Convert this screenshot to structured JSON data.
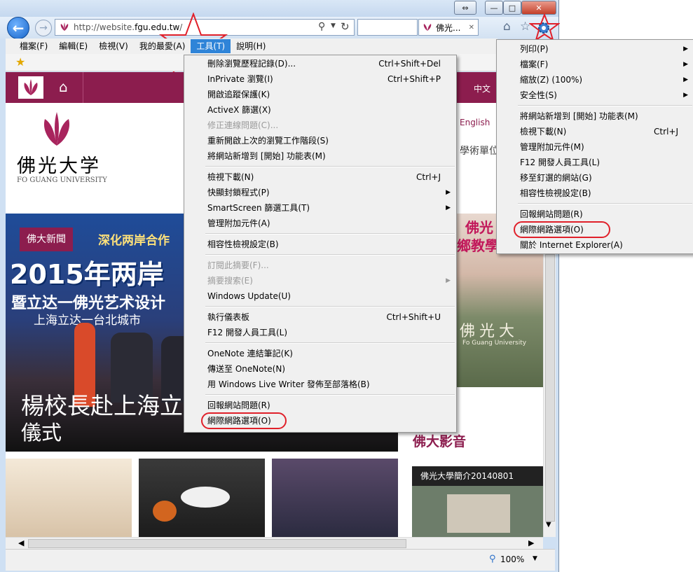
{
  "browser": {
    "url_prefix": "http://website.",
    "url_domain": "fgu.edu.tw",
    "url_suffix": "/",
    "tab_title": "佛光...",
    "tab_close": "✕",
    "zoom_label": "100%",
    "window_buttons": {
      "restore": "⇔",
      "minimize": "—",
      "maximize": "□",
      "close": "✕"
    }
  },
  "menubar": {
    "items": [
      "檔案(F)",
      "編輯(E)",
      "檢視(V)",
      "我的最愛(A)",
      "工具(T)",
      "說明(H)"
    ]
  },
  "site": {
    "lang_zh": "中文",
    "lang_en": "English",
    "dept_label": "學術單位",
    "logo_cn": "佛光大学",
    "logo_en": "FO GUANG UNIVERSITY",
    "news_badge": "佛大新聞",
    "banner_sub": "深化两岸合作",
    "banner_year": "2015年两岸",
    "banner_line2": "暨立达一佛光艺术设计",
    "banner_line3": "上海立达一台北城市",
    "headline_l1": "楊校長赴上海立",
    "headline_l2": "儀式",
    "right_top": "佛光",
    "right_mid": "鄉教學",
    "right_campus": "佛光大",
    "right_campus_en": "Fo Guang University",
    "video_title": "佛大影音",
    "video_caption": "佛光大學簡介20140801"
  },
  "tools_menu": {
    "groups": [
      [
        {
          "label": "刪除瀏覽歷程記錄(D)...",
          "shortcut": "Ctrl+Shift+Del"
        },
        {
          "label": "InPrivate 瀏覽(I)",
          "shortcut": "Ctrl+Shift+P"
        },
        {
          "label": "開啟追蹤保護(K)"
        },
        {
          "label": "ActiveX 篩選(X)"
        },
        {
          "label": "修正連線問題(C)...",
          "disabled": true
        },
        {
          "label": "重新開啟上次的瀏覽工作階段(S)"
        },
        {
          "label": "將網站新增到 [開始] 功能表(M)"
        }
      ],
      [
        {
          "label": "檢視下載(N)",
          "shortcut": "Ctrl+J"
        },
        {
          "label": "快顯封鎖程式(P)",
          "submenu": true
        },
        {
          "label": "SmartScreen 篩選工具(T)",
          "submenu": true
        },
        {
          "label": "管理附加元件(A)"
        }
      ],
      [
        {
          "label": "相容性檢視設定(B)"
        }
      ],
      [
        {
          "label": "訂閱此摘要(F)...",
          "disabled": true
        },
        {
          "label": "摘要搜索(E)",
          "disabled": true,
          "submenu": true
        },
        {
          "label": "Windows Update(U)"
        }
      ],
      [
        {
          "label": "執行儀表板",
          "shortcut": "Ctrl+Shift+U"
        },
        {
          "label": "F12 開發人員工具(L)"
        }
      ],
      [
        {
          "label": "OneNote 連結筆記(K)"
        },
        {
          "label": "傳送至 OneNote(N)"
        },
        {
          "label": "用 Windows Live Writer 發佈至部落格(B)"
        }
      ],
      [
        {
          "label": "回報網站問題(R)"
        },
        {
          "label": "網際網路選項(O)",
          "highlight": true
        }
      ]
    ]
  },
  "gear_menu": {
    "groups": [
      [
        {
          "label": "列印(P)",
          "submenu": true
        },
        {
          "label": "檔案(F)",
          "submenu": true
        },
        {
          "label": "縮放(Z) (100%)",
          "submenu": true
        },
        {
          "label": "安全性(S)",
          "submenu": true
        }
      ],
      [
        {
          "label": "將網站新增到 [開始] 功能表(M)"
        },
        {
          "label": "檢視下載(N)",
          "shortcut": "Ctrl+J"
        },
        {
          "label": "管理附加元件(M)"
        },
        {
          "label": "F12 開發人員工具(L)"
        },
        {
          "label": "移至釘選的網站(G)"
        },
        {
          "label": "相容性檢視設定(B)"
        }
      ],
      [
        {
          "label": "回報網站問題(R)"
        },
        {
          "label": "網際網路選項(O)",
          "highlight": true
        },
        {
          "label": "關於 Internet Explorer(A)"
        }
      ]
    ]
  },
  "colors": {
    "site_primary": "#8c1d4e",
    "annotation_red": "#e0202a",
    "ie_blue": "#1664c8"
  }
}
